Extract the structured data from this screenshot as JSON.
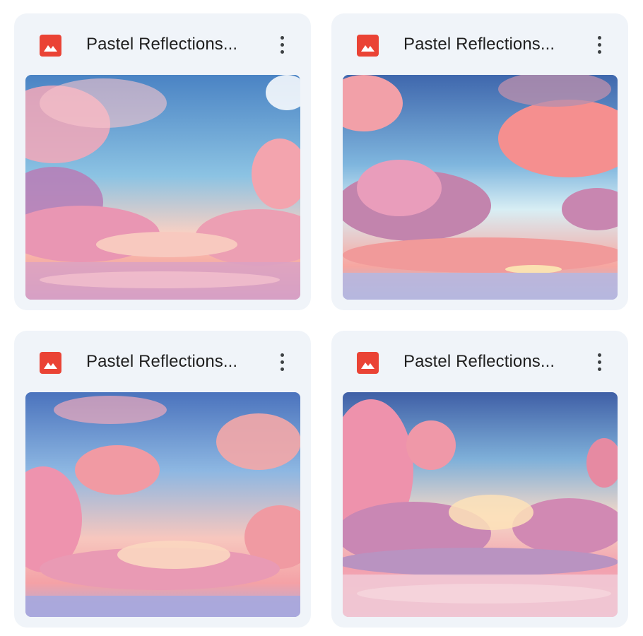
{
  "files": [
    {
      "title": "Pastel Reflections...",
      "icon": "image-file-icon",
      "menu_icon": "more-vert-icon"
    },
    {
      "title": "Pastel Reflections...",
      "icon": "image-file-icon",
      "menu_icon": "more-vert-icon"
    },
    {
      "title": "Pastel Reflections...",
      "icon": "image-file-icon",
      "menu_icon": "more-vert-icon"
    },
    {
      "title": "Pastel Reflections...",
      "icon": "image-file-icon",
      "menu_icon": "more-vert-icon"
    }
  ],
  "colors": {
    "card_background": "#f0f4f9",
    "file_icon": "#ea4335",
    "title_text": "#1f1f1f",
    "menu_dots": "#3c4043"
  }
}
